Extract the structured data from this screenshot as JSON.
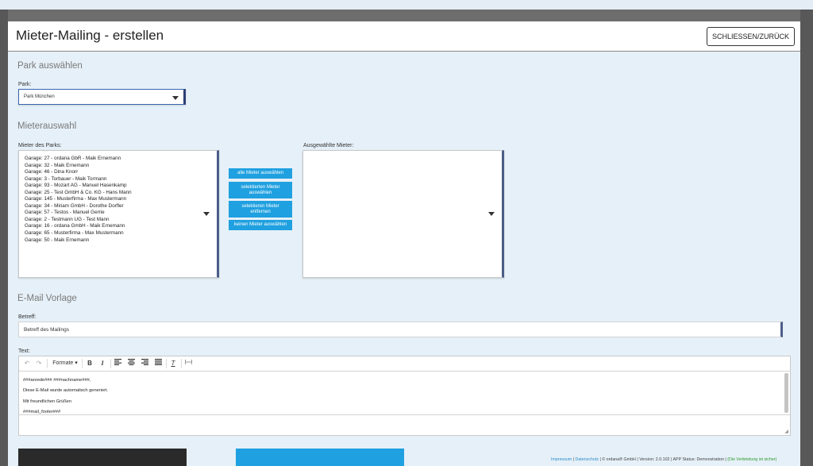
{
  "modal": {
    "title": "Mieter-Mailing - erstellen",
    "close_label": "SCHLIESSEN/ZURÜCK"
  },
  "park_section": {
    "title": "Park auswählen",
    "label": "Park:",
    "selected": "Park München"
  },
  "tenant_section": {
    "title": "Mieterauswahl",
    "available_label": "Mieter des Parks:",
    "selected_label": "Ausgewählte Mieter:",
    "available_items": [
      "Garage: 27 - ordana GbR - Maik Ernemann",
      "Garage: 32 - Maik Ernemann",
      "Garage: 46 - Dina Knorr",
      "Garage: 3 - Torbauer - Maik Tormann",
      "Garage: 93 - Mozart AG - Manuel Hasenkamp",
      "Garage: 25 - Test GmbH & Co. KG - Hans Mann",
      "Garage: 145 - Musterfirma - Max Mustermann",
      "Garage: 34 - Miriam GmbH - Dorothe Dorfler",
      "Garage: 57 - Testos - Manuel Gerrie",
      "Garage: 2 - Testmann UG - Test Mann",
      "Garage: 16 - ordana GmbH - Maik Ernemann",
      "Garage: 65 - Musterfirma - Max Mustermann",
      "Garage: 50 - Maik Ernemann"
    ],
    "buttons": {
      "select_all": "alle Mieter auswählen",
      "select_selected_1": "selektierten Mieter",
      "select_selected_2": "auswählen",
      "remove_selected_1": "selektieren Mieter",
      "remove_selected_2": "entfernen",
      "select_none": "keinen Mieter auswählen"
    }
  },
  "email_section": {
    "title": "E-Mail Vorlage",
    "subject_label": "Betreff:",
    "subject_value": "Betreff des Mailings",
    "text_label": "Text:",
    "toolbar_format": "Formate",
    "body_lines": [
      "###anrede### ###nachname###,",
      "Diese E-Mail wurde automatisch generiert.",
      "Mit freundlichen Grüßen",
      "###mail_footer###"
    ]
  },
  "footer": {
    "impressum": "Impressum",
    "datenschutz": "Datenschutz",
    "company": "© ordana® GmbH",
    "version": "Version: 2.0.102",
    "app_status": "APP Status: Demonstration",
    "connection": "(Die Verbindung ist sicher)"
  },
  "colors": {
    "accent_blue": "#1fa0e0",
    "panel_bg": "#e6f0f8",
    "select_border": "#4b5d88"
  }
}
